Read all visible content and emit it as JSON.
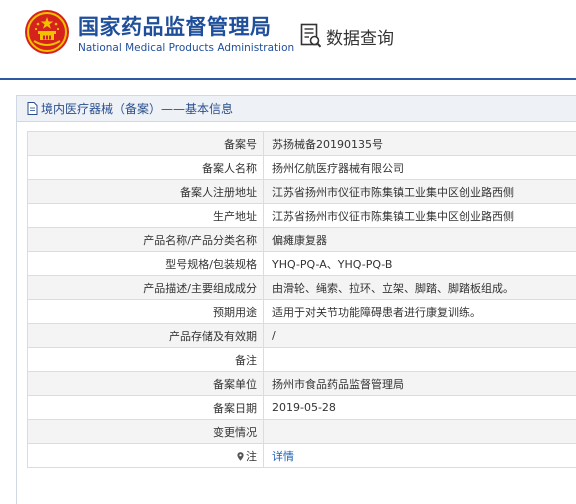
{
  "header": {
    "brand_cn": "国家药品监督管理局",
    "brand_en": "National Medical Products Administration",
    "query_label": "数据查询"
  },
  "panel": {
    "title": "境内医疗器械（备案）——基本信息"
  },
  "rows": [
    {
      "label": "备案号",
      "value": "苏扬械备20190135号"
    },
    {
      "label": "备案人名称",
      "value": "扬州亿航医疗器械有限公司"
    },
    {
      "label": "备案人注册地址",
      "value": "江苏省扬州市仪征市陈集镇工业集中区创业路西侧"
    },
    {
      "label": "生产地址",
      "value": "江苏省扬州市仪征市陈集镇工业集中区创业路西侧"
    },
    {
      "label": "产品名称/产品分类名称",
      "value": "偏瘫康复器"
    },
    {
      "label": "型号规格/包装规格",
      "value": "YHQ-PQ-A、YHQ-PQ-B"
    },
    {
      "label": "产品描述/主要组成成分",
      "value": "由滑轮、绳索、拉环、立架、脚踏、脚踏板组成。"
    },
    {
      "label": "预期用途",
      "value": "适用于对关节功能障碍患者进行康复训练。"
    },
    {
      "label": "产品存储及有效期",
      "value": "/"
    },
    {
      "label": "备注",
      "value": ""
    },
    {
      "label": "备案单位",
      "value": "扬州市食品药品监督管理局"
    },
    {
      "label": "备案日期",
      "value": "2019-05-28"
    },
    {
      "label": "变更情况",
      "value": ""
    },
    {
      "label": "注",
      "value": "详情"
    }
  ],
  "colors": {
    "brand_blue": "#1f4e9a",
    "emblem_red": "#d6221c",
    "emblem_gold": "#f2c200",
    "link_blue": "#1f5fb4"
  },
  "icons": {
    "emblem": "national-emblem-icon",
    "query": "document-search-icon",
    "panel": "document-icon",
    "note": "location-pin-icon"
  }
}
